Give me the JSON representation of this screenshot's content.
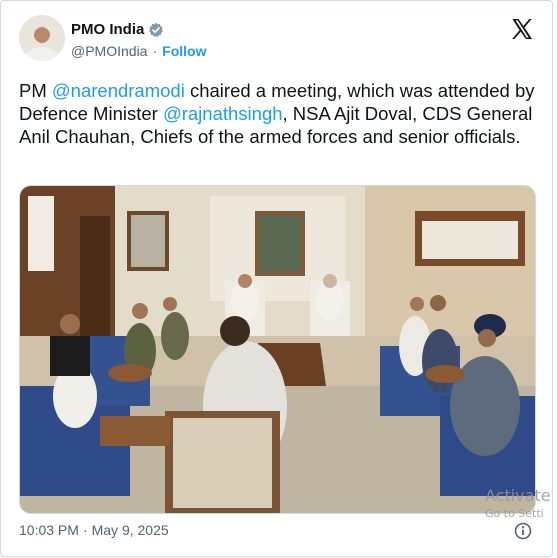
{
  "account": {
    "display_name": "PMO India",
    "handle": "@PMOIndia",
    "separator": "·",
    "follow_label": "Follow"
  },
  "tweet": {
    "text_parts": {
      "p1": "PM ",
      "m1": "@narendramodi",
      "p2": " chaired a meeting, which was attended by Defence Minister ",
      "m2": "@rajnathsingh",
      "p3": ", NSA Ajit Doval, CDS General Anil Chauhan, Chiefs of the armed forces and senior officials."
    },
    "time": "10:03 PM",
    "separator": "·",
    "date": "May 9, 2025"
  },
  "watermark": {
    "line1": "Activate",
    "line2": "Go to Setti"
  },
  "icons": {
    "verified": "verified-badge-icon",
    "x_logo": "x-logo-icon",
    "info": "info-icon"
  },
  "colors": {
    "link": "#1d9bf0",
    "secondary_text": "#536471",
    "text": "#0f1419"
  }
}
